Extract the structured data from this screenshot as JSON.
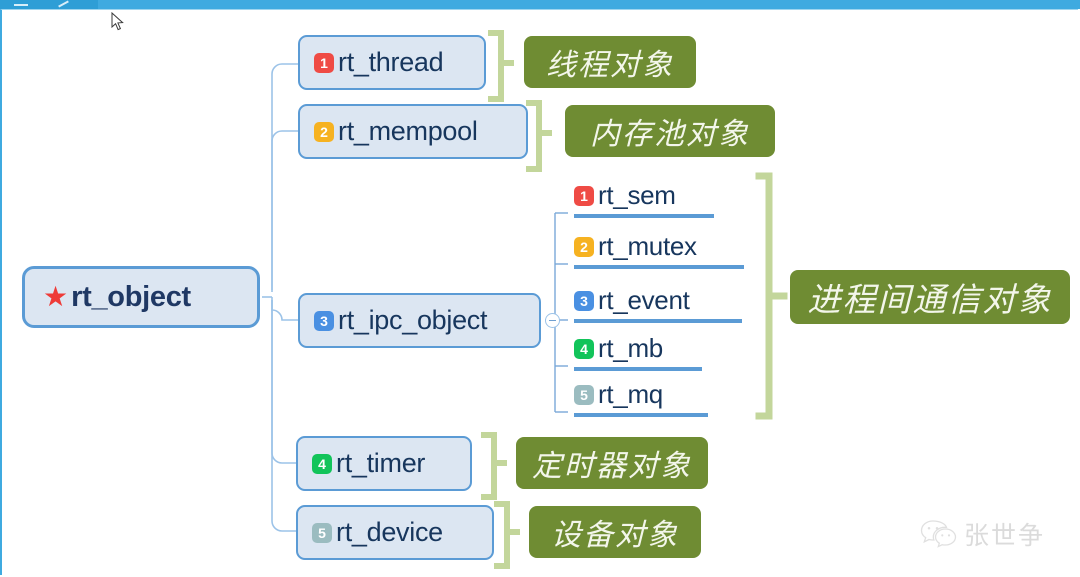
{
  "window": {
    "top_bar_color": "#3faae0",
    "tab_color": "#2e9ed6"
  },
  "mindmap": {
    "root": {
      "label": "rt_object",
      "icon": "red-star",
      "star_color": "#ee3b38",
      "fill": "#dce6f2",
      "border": "#5b9bd5"
    },
    "branches": [
      {
        "badge": "1",
        "badge_color": "#ef4b45",
        "label": "rt_thread",
        "annotation": "线程对象"
      },
      {
        "badge": "2",
        "badge_color": "#f6b221",
        "label": "rt_mempool",
        "annotation": "内存池对象"
      },
      {
        "badge": "3",
        "badge_color": "#4a90e2",
        "label": "rt_ipc_object",
        "annotation": "进程间通信对象",
        "collapsed": false
      },
      {
        "badge": "4",
        "badge_color": "#12c45a",
        "label": "rt_timer",
        "annotation": "定时器对象"
      },
      {
        "badge": "5",
        "badge_color": "#9bbcc0",
        "label": "rt_device",
        "annotation": "设备对象"
      }
    ],
    "ipc_children": [
      {
        "badge": "1",
        "badge_color": "#ef4b45",
        "label": "rt_sem"
      },
      {
        "badge": "2",
        "badge_color": "#f6b221",
        "label": "rt_mutex"
      },
      {
        "badge": "3",
        "badge_color": "#4a90e2",
        "label": "rt_event"
      },
      {
        "badge": "4",
        "badge_color": "#12c45a",
        "label": "rt_mb"
      },
      {
        "badge": "5",
        "badge_color": "#9bbcc0",
        "label": "rt_mq"
      }
    ],
    "annotation_style": {
      "background": "#6f8c33",
      "text_color": "#f3f6ea",
      "bracket_color": "#c3d69b"
    }
  },
  "watermark": {
    "icon": "wechat-icon",
    "text": "张世争"
  }
}
